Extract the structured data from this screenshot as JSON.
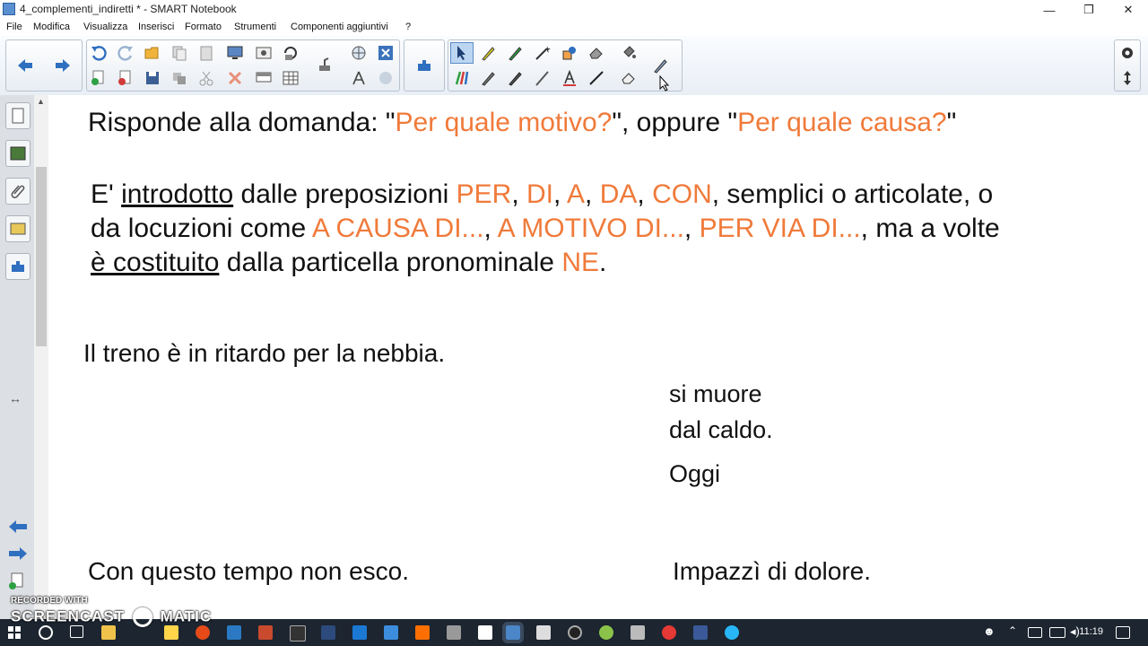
{
  "window": {
    "title": "4_complementi_indiretti * - SMART Notebook",
    "controls": {
      "minimize": "—",
      "restore": "❐",
      "close": "✕"
    }
  },
  "menu": [
    "File",
    "Modifica",
    "Visualizza",
    "Inserisci",
    "Formato",
    "Strumenti",
    "Componenti aggiuntivi",
    "?"
  ],
  "toolbar": {
    "nav_icons": [
      "back-arrow-icon",
      "forward-arrow-icon"
    ],
    "file_icons": [
      "undo-icon",
      "redo-icon",
      "open-folder-icon",
      "copy-icon",
      "paste-icon",
      "screen-capture-icon",
      "camera-icon",
      "rotate-icon",
      "globe-icon",
      "delete-x-icon",
      "add-page-icon",
      "delete-page-icon",
      "save-icon",
      "clone-icon",
      "cut-icon",
      "delete-icon",
      "screen-shade-icon",
      "table-icon",
      "document-camera-icon",
      "compass-icon",
      "response-icon",
      "addons-icon"
    ],
    "tool_icons": [
      "select-arrow-icon",
      "highlighter-icon",
      "pen-icon",
      "magic-pen-icon",
      "shapes-icon",
      "eraser-shape-icon",
      "fill-icon",
      "creative-pen-icon",
      "pencil-icon",
      "calligraphy-pen-icon",
      "brush-icon",
      "text-tool-icon",
      "line-tool-icon",
      "eraser-icon",
      "properties-pen-icon"
    ],
    "right_icons": [
      "gear-icon",
      "move-toolbar-icon"
    ]
  },
  "slide": {
    "line1": {
      "a": "Risponde alla domanda: \"",
      "b": "Per quale motivo?",
      "c": "\", oppure \"",
      "d": "Per quale causa?",
      "e": "\""
    },
    "para": {
      "l1a": "E' ",
      "l1b": "introdotto",
      "l1c": " dalle preposizioni ",
      "p1": "PER",
      "s1": ", ",
      "p2": "DI",
      "s2": ", ",
      "p3": "A",
      "s3": ", ",
      "p4": "DA",
      "s4": ", ",
      "p5": "CON",
      "l1d": ", semplici o articolate, o",
      "l2a": "da locuzioni come ",
      "loc1": "A CAUSA DI...",
      "s5": ", ",
      "loc2": "A MOTIVO DI...",
      "s6": ", ",
      "loc3": "PER VIA DI...",
      "l2b": ", ma a volte",
      "l3a": "è costituito",
      "l3b": " dalla particella pronominale ",
      "ne": "NE",
      "l3c": "."
    },
    "ex1": "Il treno è in ritardo per la nebbia.",
    "ex2a": "si muore",
    "ex2b": "dal caldo.",
    "ex3": "Oggi",
    "ex4": "Con questo tempo non esco.",
    "ex5": "Impazzì di dolore."
  },
  "watermark": {
    "line1": "RECORDED WITH",
    "line2": "SCREENCAST",
    "line3": "MATIC"
  },
  "tray": {
    "time": "11:19"
  },
  "colors": {
    "accent_orange": "#f07a3a",
    "taskbar": "#1c2530"
  }
}
